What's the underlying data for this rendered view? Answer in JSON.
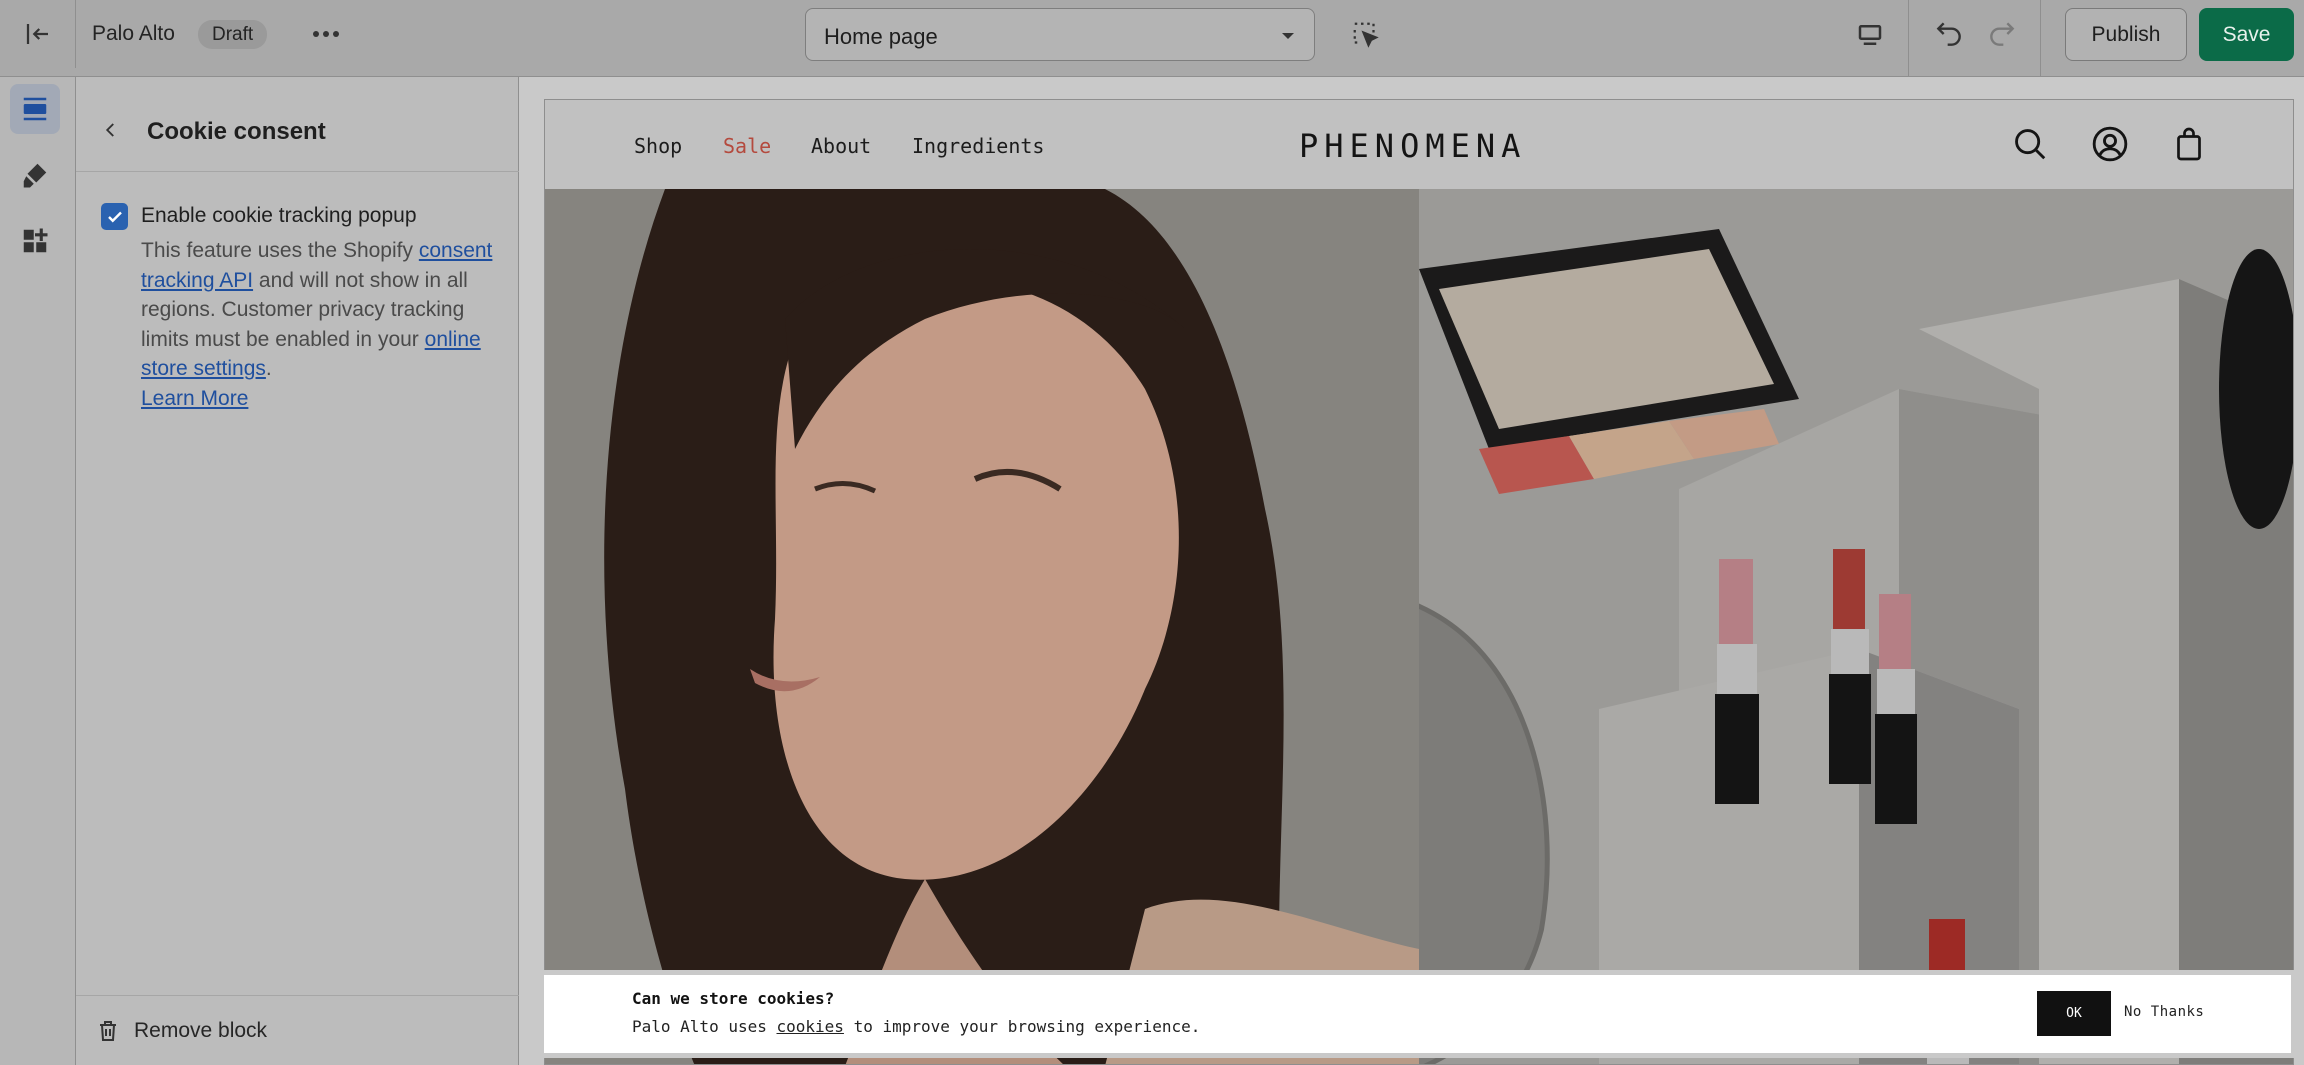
{
  "topbar": {
    "store_name": "Palo Alto",
    "status_badge": "Draft",
    "page_selector": "Home page",
    "publish_label": "Publish",
    "save_label": "Save"
  },
  "panel": {
    "title": "Cookie consent",
    "checkbox_label": "Enable cookie tracking popup",
    "checkbox_checked": true,
    "help_text_1": "This feature uses the Shopify",
    "help_link_1": "consent tracking API",
    "help_text_2": "and will not show in all regions. Customer privacy tracking limits must be enabled in your",
    "help_link_2": "online store settings",
    "help_text_3": ".",
    "help_link_3": "Learn More",
    "remove_label": "Remove block"
  },
  "preview": {
    "nav": [
      "Shop",
      "Sale",
      "About",
      "Ingredients"
    ],
    "brand": "PHENOMENA",
    "sale_color": "#b44a3e"
  },
  "cookie_banner": {
    "title": "Can we store cookies?",
    "text_before": "Palo Alto uses ",
    "link": "cookies",
    "text_after": " to improve your browsing experience.",
    "ok_label": "OK",
    "no_thanks_label": "No Thanks"
  },
  "colors": {
    "accent_green": "#0b6b48",
    "checkbox_blue": "#2a62b0",
    "link_blue": "#1f4f9e"
  }
}
